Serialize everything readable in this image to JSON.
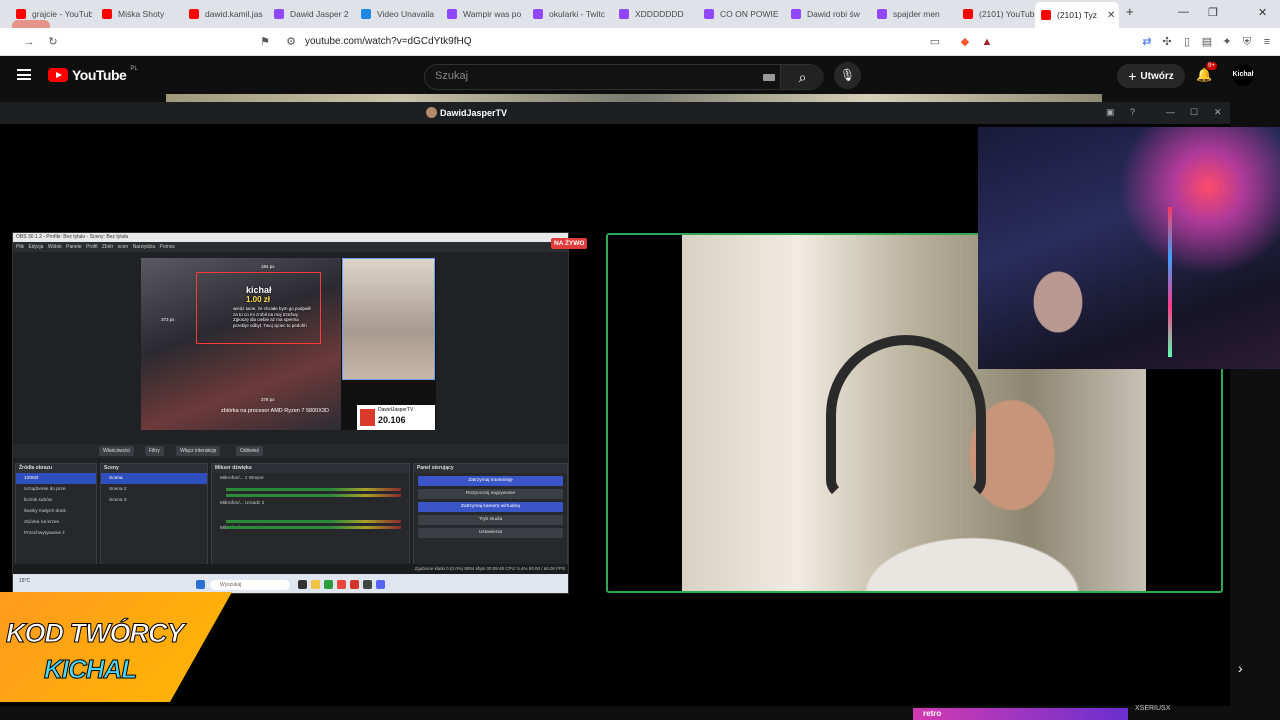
{
  "browser": {
    "tabs": [
      {
        "label": "grajcie - YouTube",
        "color": "#ff0000"
      },
      {
        "label": "Miśka Shoty",
        "color": "#ff0000"
      },
      {
        "label": "dawid.kamil.jas",
        "color": "#ff0000"
      },
      {
        "label": "Dawid Jasper 2",
        "color": "#9146ff"
      },
      {
        "label": "Video Unavaila",
        "color": "#1e88e5"
      },
      {
        "label": "Wampir was po",
        "color": "#9146ff"
      },
      {
        "label": "okularki - Twitc",
        "color": "#9146ff"
      },
      {
        "label": "XDDDDDDD",
        "color": "#9146ff"
      },
      {
        "label": "CO ON POWIE",
        "color": "#9146ff"
      },
      {
        "label": "Dawid robi św",
        "color": "#9146ff"
      },
      {
        "label": "spajder men",
        "color": "#9146ff"
      },
      {
        "label": "(2101) YouTub",
        "color": "#ff0000"
      },
      {
        "label": "(2101) Tyz",
        "color": "#ff0000"
      }
    ],
    "url": "youtube.com/watch?v=dGCdYtk9fHQ",
    "new_tab": "+"
  },
  "youtube": {
    "logo_text": "YouTube",
    "country": "PL",
    "search_placeholder": "Szukaj",
    "create_label": "Utwórz",
    "notif_count": "9+",
    "avatar_text": "Kichał"
  },
  "stream": {
    "title": "DawidJasperTV",
    "live_badge": "NA ŻYWO"
  },
  "obs": {
    "window_title": "OBS 30.1.2 - Profile: Bez tytułu - Sceny: Bez tytułu",
    "menu": "Plik  Edycja  Widok  Panele  Profil  Zbiór scen  Narzędzia  Pomoc",
    "overlay_name": "kichał",
    "overlay_amount": "1.00 zł",
    "overlay_msg": "wiedz tacie, że chciałe bym go podpalił za to co mi zrobił na moj trzeźwy. Zgłoszę dla ciebie aż ma sperma przebije odbyt. Twoj ojciec to pedofil i",
    "caption": "zbiórka na procesor AMD Ryzen 7 5800X3D",
    "tip_name": "DawidJasperTV",
    "tip_value": "20.106",
    "px_labels": [
      "184 px",
      "373 px",
      "378 px"
    ],
    "toolbar": [
      "Właściwości",
      "Filtry",
      "Włącz interakcję",
      "Odśwież"
    ],
    "panels": {
      "sources_title": "Źródła obrazu",
      "sources": [
        "1200zł",
        "Urządzenie do prze",
        "licznik subów",
        "śwoby małych donk",
        "zbiórka na krzes",
        "Przechwytywanie ż"
      ],
      "scenes_title": "Sceny",
      "scenes": [
        "Scena",
        "Scena 2",
        "Scena 3"
      ],
      "mixer_title": "Mikser dźwięku",
      "mixer_labels": [
        "Mikrofon/... z Wnęce",
        "Mikrofon/... Urzadz 2",
        "Mikrofon/... Urzadz 3"
      ],
      "controls_title": "Panel sterujący",
      "controls": [
        "Zatrzymaj transmisję",
        "Rozpocznij nagrywanie",
        "Zatrzymaj kamerę wirtualną",
        "Tryb studia",
        "Ustawienia"
      ]
    },
    "status": "Zgubione klatki 0 (0.0%)   8004 kbps   00:09:48   CPU: 5.4%   60.00 / 60.00 FPS",
    "taskbar_search": "Wyszukaj",
    "taskbar_weather": "15°C"
  },
  "banner": {
    "line1": "KOD TWÓRCY",
    "line2": "KICHAL"
  },
  "bottom": {
    "ad_text": "retro",
    "label": "XSERIUSX"
  }
}
